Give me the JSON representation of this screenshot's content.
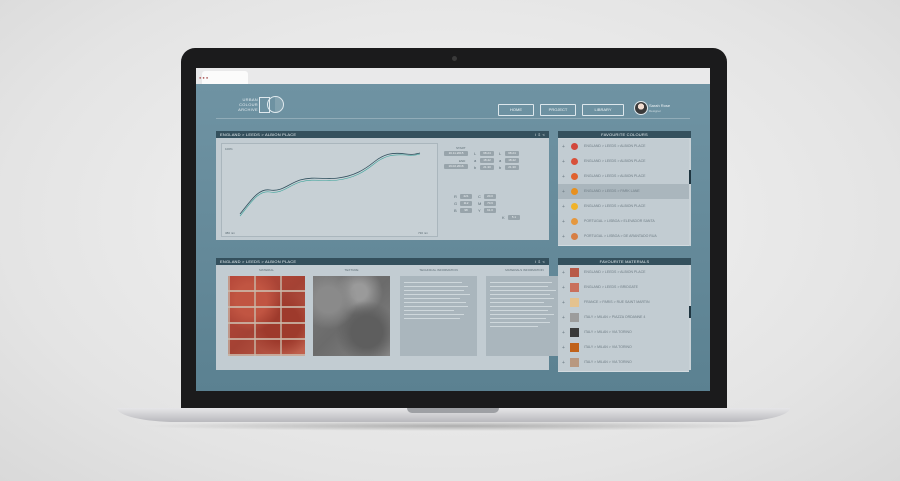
{
  "logo": {
    "line1": "URBAN",
    "line2": "COLOUR",
    "line3": "ARCHIVE"
  },
  "nav": {
    "home": "HOME",
    "project": "PROJECT",
    "library": "LIBRARY"
  },
  "user": {
    "name": "Sarah Rose",
    "role": "Designer"
  },
  "chart_panel": {
    "title": "ENGLAND > LEEDS > ALBION PLACE",
    "icons": "i ⇩ <",
    "y_top_label": "100%",
    "x_left_label": "380 nm",
    "x_right_label": "730 nm",
    "start_label": "START",
    "end_label": "END",
    "start_value": "16.11.2015",
    "end_value": "19.02.2016",
    "grid1": [
      [
        "L",
        "68.24"
      ],
      [
        "a",
        "18.42"
      ],
      [
        "b",
        "21.30"
      ],
      [
        "L",
        "68.24"
      ],
      [
        "a",
        "18.42"
      ],
      [
        "b",
        "21.30"
      ]
    ],
    "grid2": [
      [
        "R",
        "221"
      ],
      [
        "G",
        "112"
      ],
      [
        "B",
        "98"
      ],
      [
        "C",
        "20.0"
      ],
      [
        "M",
        "70.6"
      ],
      [
        "Y",
        "61.0"
      ],
      [
        "K",
        "5.1"
      ]
    ]
  },
  "materials_panel": {
    "title": "ENGLAND > LEEDS > ALBION PLACE",
    "icons": "i ⇩ <",
    "col_material": "MATERIAL",
    "col_texture": "TEXTURE",
    "col_technical": "TECHNICAL INFORMATION",
    "col_material_info": "MATERIALS INFORMATION"
  },
  "favourite_colours": {
    "title": "FAVOURITE COLOURS",
    "items": [
      {
        "label": "ENGLAND > LEEDS > ALBION PLACE",
        "color": "#d2473c"
      },
      {
        "label": "ENGLAND > LEEDS > ALBION PLACE",
        "color": "#d8503a"
      },
      {
        "label": "ENGLAND > LEEDS > ALBION PLACE",
        "color": "#e0612e"
      },
      {
        "label": "ENGLAND > LEEDS > PARK LANE",
        "color": "#e8901e"
      },
      {
        "label": "ENGLAND > LEEDS > ALBION PLACE",
        "color": "#f0b32a"
      },
      {
        "label": "PORTUGAL > LISBOA > ELEVADOR SANTA",
        "color": "#e5983f"
      },
      {
        "label": "PORTUGAL > LISBOA > DE ARANTADO RUA",
        "color": "#d67e44"
      }
    ]
  },
  "favourite_materials": {
    "title": "FAVOURITE MATERIALS",
    "items": [
      {
        "label": "ENGLAND > LEEDS > ALBION PLACE",
        "color": "#b85a48"
      },
      {
        "label": "ENGLAND > LEEDS > BRIDGATE",
        "color": "#c9705c"
      },
      {
        "label": "FRANCE > PARIS > RUE SAINT MARTIN",
        "color": "#e4c28f"
      },
      {
        "label": "ITALY > MILAN > PIAZZA ORDANNE 4",
        "color": "#9c9c9c"
      },
      {
        "label": "ITALY > MILAN > VIA TORINO",
        "color": "#3a3a3a"
      },
      {
        "label": "ITALY > MILAN > VIA TORINO",
        "color": "#c0621a"
      },
      {
        "label": "ITALY > MILAN > VIA TORINO",
        "color": "#b89880"
      }
    ]
  }
}
